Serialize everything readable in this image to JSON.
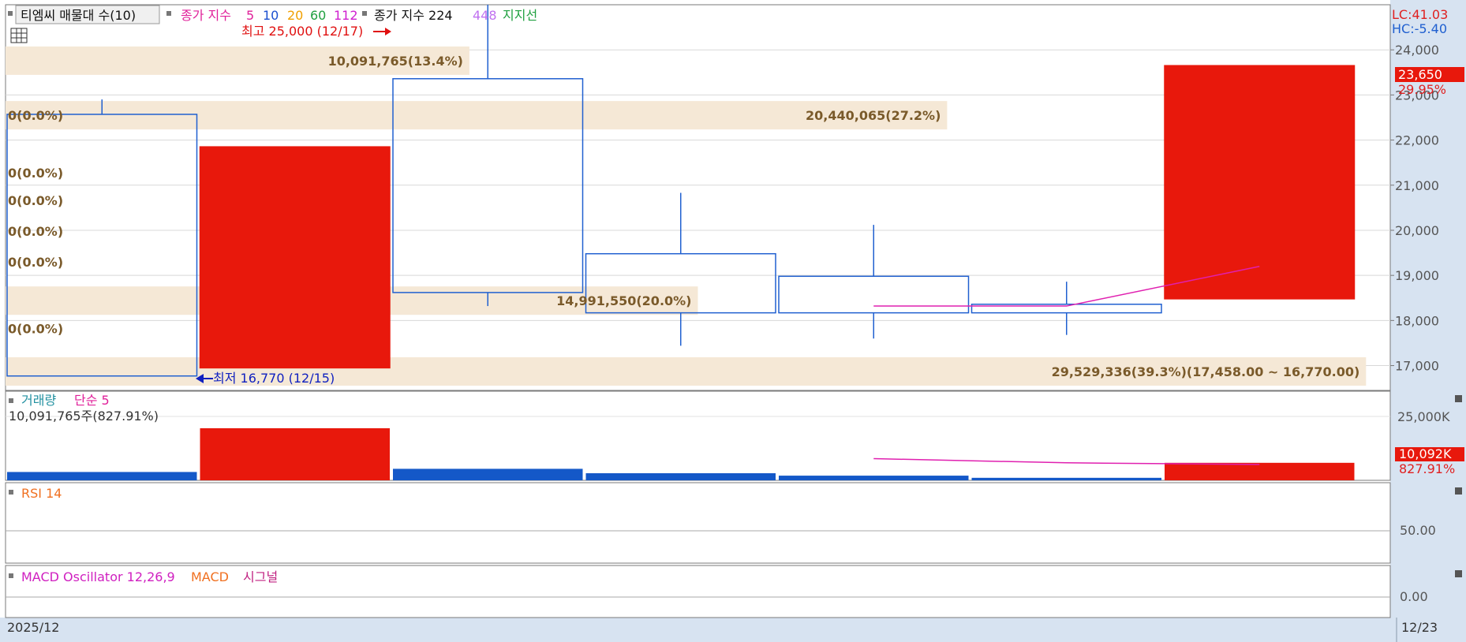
{
  "header": {
    "symbol_label": "티엠씨 매물대 수(10)",
    "ma_label": "종가 지수",
    "ma_periods": [
      "5",
      "10",
      "20",
      "60",
      "112"
    ],
    "ma_colors": [
      "#e0209a",
      "#1a4fd0",
      "#f0a000",
      "#20a040",
      "#d020d0"
    ],
    "ma2_label": "종가 지수 224",
    "ma2_extra": "448",
    "support_label": "지지선",
    "lc": "LC:41.03",
    "hc": "HC:-5.40"
  },
  "annotations": {
    "high": "최고 25,000 (12/17)",
    "low": "최저 16,770 (12/15)"
  },
  "panels": {
    "volume": {
      "title": "거래량",
      "ma": "단순 5",
      "last_value": "10,092K",
      "last_pct": "827.91%",
      "top_label": "10,091,765주(827.91%)",
      "tick": "25,000K"
    },
    "rsi": {
      "title": "RSI 14",
      "tick": "50.00"
    },
    "macd": {
      "title": "MACD Oscillator 12,26,9",
      "macd": "MACD",
      "signal": "시그널",
      "tick": "0.00"
    }
  },
  "xaxis": {
    "start": "2025/12",
    "end": "12/23"
  },
  "price_tag": {
    "value": "23,650",
    "pct": "29.95%"
  },
  "colors": {
    "up": "#e8180c",
    "down_outline": "#2060d0",
    "volume_down": "#1458c8",
    "band": "#f5e8d6",
    "ma_line": "#e020b0",
    "axis_bg": "#d7e3f1"
  },
  "chart_data": {
    "type": "candlestick",
    "yticks": [
      17000,
      18000,
      19000,
      20000,
      21000,
      22000,
      23000,
      24000
    ],
    "ytick_labels": [
      "17,000",
      "18,000",
      "19,000",
      "20,000",
      "21,000",
      "22,000",
      "23,000",
      "24,000"
    ],
    "ylim": [
      16450,
      25000
    ],
    "candles": [
      {
        "open": 22570,
        "high": 22900,
        "low": 16770,
        "close": 16770,
        "volume": 1000000,
        "up": false
      },
      {
        "open": 16950,
        "high": 21850,
        "low": 16950,
        "close": 21850,
        "volume": 6250000,
        "up": true
      },
      {
        "open": 23360,
        "high": 25000,
        "low": 18320,
        "close": 18620,
        "volume": 1380000,
        "up": false
      },
      {
        "open": 19480,
        "high": 20830,
        "low": 17440,
        "close": 18170,
        "volume": 850000,
        "up": false
      },
      {
        "open": 18980,
        "high": 20120,
        "low": 17600,
        "close": 18170,
        "volume": 560000,
        "up": false
      },
      {
        "open": 18360,
        "high": 18860,
        "low": 17680,
        "close": 18170,
        "volume": 300000,
        "up": false
      },
      {
        "open": 18480,
        "high": 23650,
        "low": 18480,
        "close": 23650,
        "volume": 2100000,
        "up": true
      }
    ],
    "ma5": [
      null,
      null,
      null,
      null,
      18320,
      18320,
      19200
    ],
    "volume_ma5": [
      null,
      null,
      null,
      null,
      2600000,
      2100000,
      1900000
    ],
    "volume_ylim": [
      0,
      10600000
    ],
    "volume_profile": [
      {
        "label": "0(0.0%)",
        "price": 22550,
        "width": 0
      },
      {
        "label": "0(0.0%)",
        "price": 21280,
        "width": 0
      },
      {
        "label": "0(0.0%)",
        "price": 20660,
        "width": 0
      },
      {
        "label": "0(0.0%)",
        "price": 19980,
        "width": 0
      },
      {
        "label": "0(0.0%)",
        "price": 19300,
        "width": 0
      },
      {
        "label": "0(0.0%)",
        "price": 17820,
        "width": 0
      },
      {
        "label": "10,091,765(13.4%)",
        "price": 23760,
        "width": 0.134
      },
      {
        "label": "20,440,065(27.2%)",
        "price": 22550,
        "width": 0.272
      },
      {
        "label": "14,991,550(20.0%)",
        "price": 18440,
        "width": 0.2
      },
      {
        "label": "29,529,336(39.3%)(17,458.00 ~ 16,770.00)",
        "price": 16870,
        "width": 0.393
      }
    ]
  }
}
